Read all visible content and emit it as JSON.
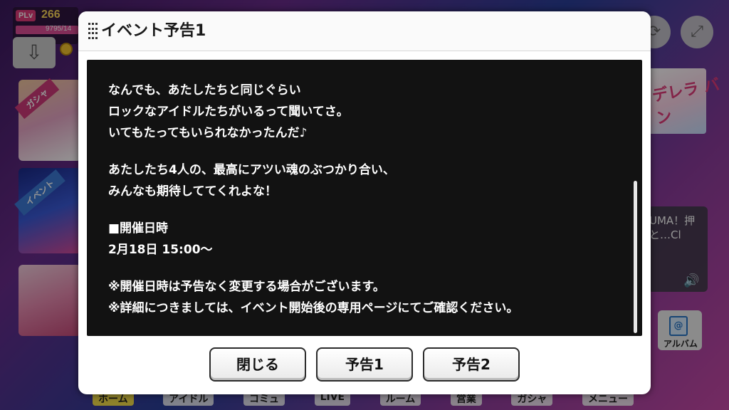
{
  "background": {
    "player_level_tag": "PLv",
    "player_level": "266",
    "stamina_text": "9795/14",
    "banner_text": "デレラ バン",
    "info_text": "UMA！押 と…Cl",
    "album_label": "アルバム",
    "nav": [
      "ホーム",
      "アイドル",
      "コミュ",
      "LIVE",
      "ルーム",
      "営業",
      "ガシャ",
      "メニュー"
    ],
    "ribbons": [
      "ガシャ",
      "イベント"
    ]
  },
  "modal": {
    "title": "イベント予告1",
    "lines": [
      "なんでも、あたしたちと同じぐらい",
      "ロックなアイドルたちがいるって聞いてさ。",
      "いてもたってもいられなかったんだ♪",
      "",
      "あたしたち4人の、最高にアツい魂のぶつかり合い、",
      "みんなも期待しててくれよな！",
      "",
      "■開催日時",
      "2月18日 15:00〜",
      "",
      "※開催日時は予告なく変更する場合がございます。",
      "※詳細につきましては、イベント開始後の専用ページにてご確認ください。"
    ],
    "buttons": {
      "close": "閉じる",
      "notice1": "予告1",
      "notice2": "予告2"
    }
  }
}
